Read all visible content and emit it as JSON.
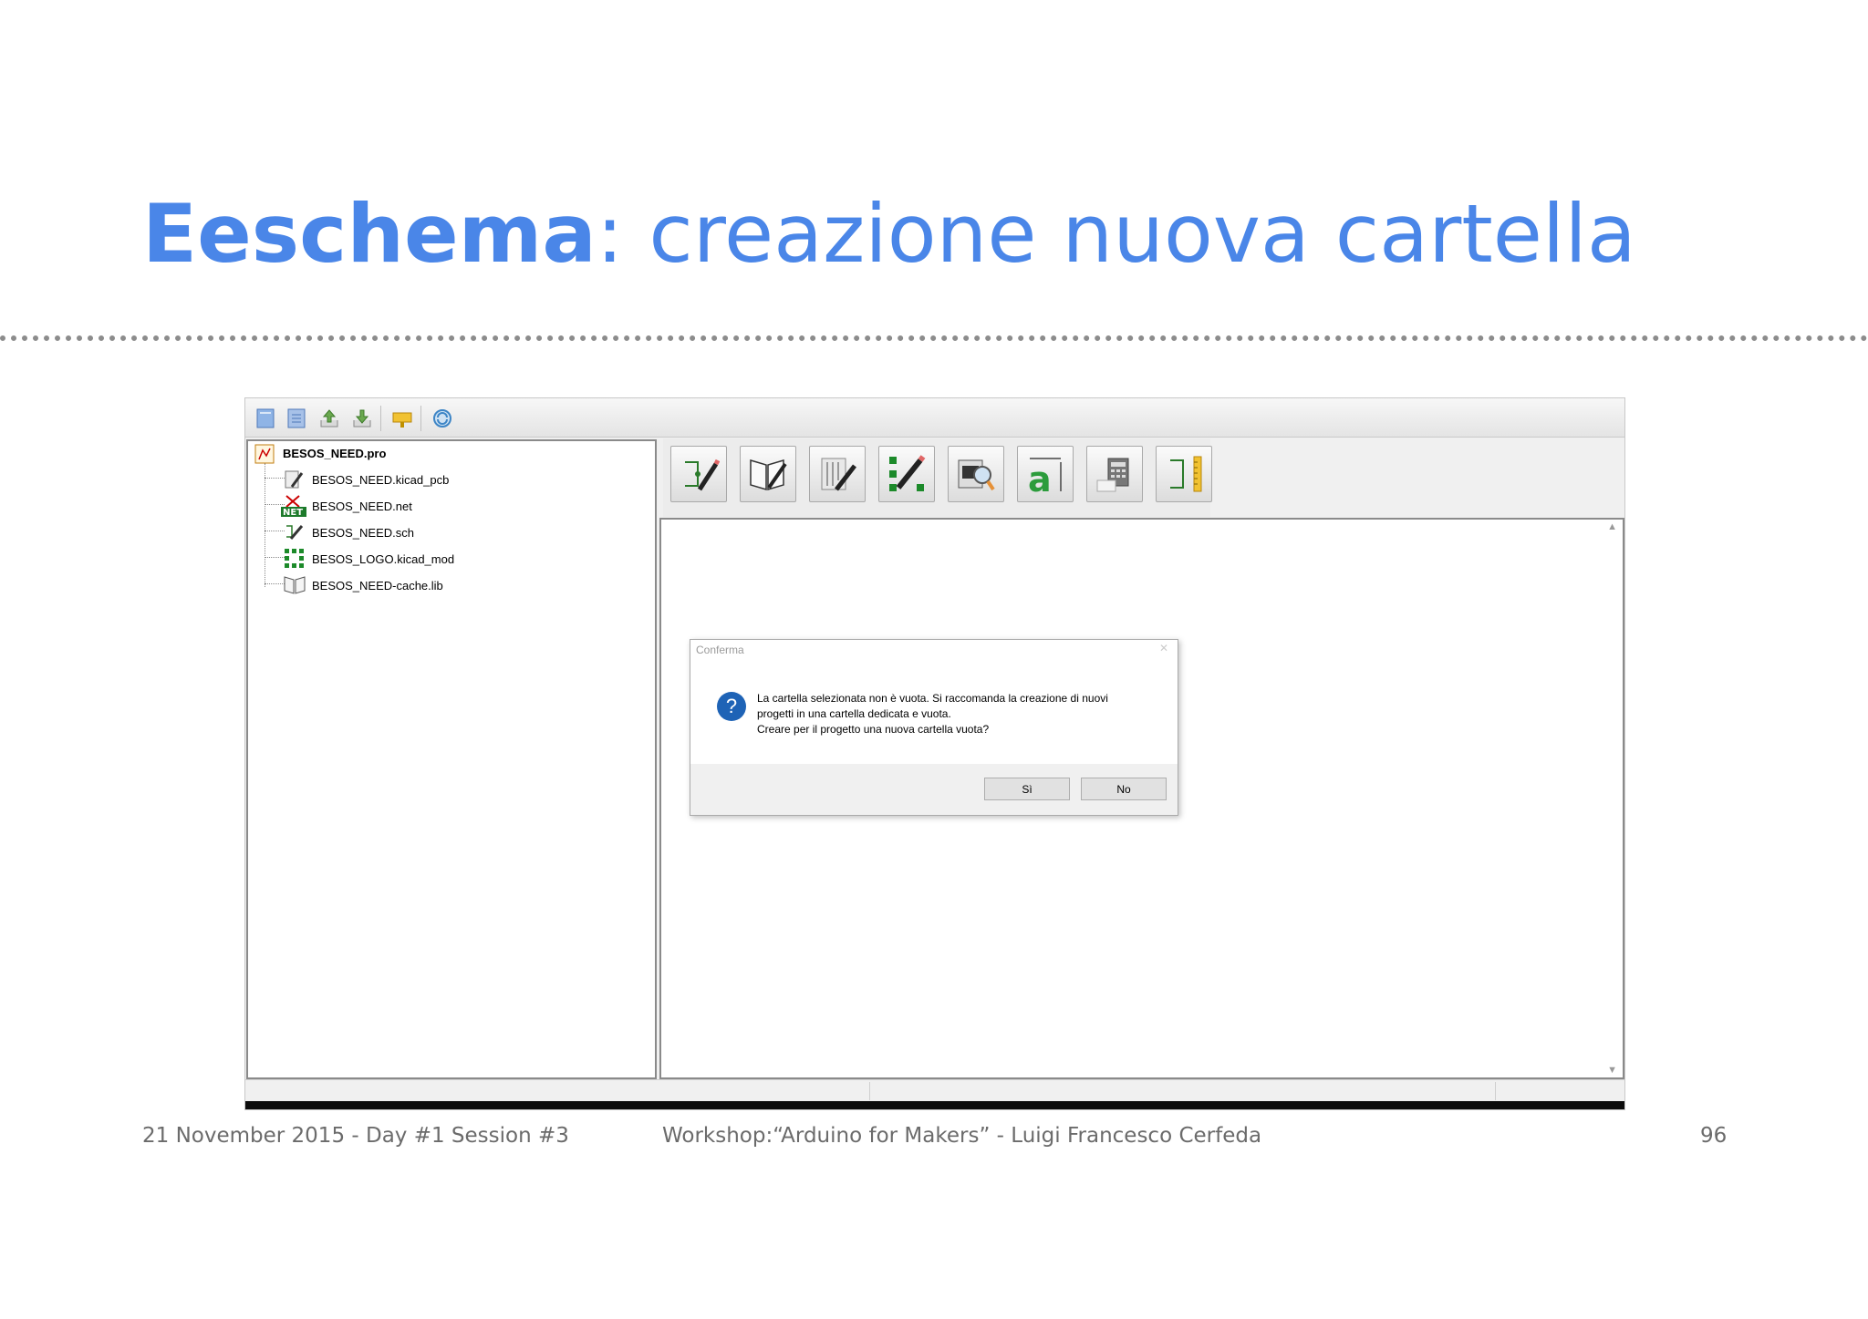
{
  "slide": {
    "title_bold": "Eeschema",
    "title_rest": ": creazione nuova cartella",
    "title_color": "#4a86e8"
  },
  "toolbar": {
    "icons": [
      "new-project-icon",
      "new-project-from-template-icon",
      "open-project-icon",
      "save-project-icon",
      "archive-icon",
      "refresh-icon"
    ]
  },
  "tree": {
    "root": "BESOS_NEED.pro",
    "items": [
      {
        "label": "BESOS_NEED.kicad_pcb",
        "icon": "pcb-file-icon"
      },
      {
        "label": "BESOS_NEED.net",
        "icon": "netlist-file-icon"
      },
      {
        "label": "BESOS_NEED.sch",
        "icon": "schematic-file-icon"
      },
      {
        "label": "BESOS_LOGO.kicad_mod",
        "icon": "footprint-file-icon"
      },
      {
        "label": "BESOS_NEED-cache.lib",
        "icon": "library-file-icon"
      }
    ]
  },
  "tools": [
    "eeschema-icon",
    "library-editor-icon",
    "pcbnew-icon",
    "footprint-editor-icon",
    "gerber-view-icon",
    "bitmap2component-icon",
    "pcb-calculator-icon",
    "worksheet-editor-icon"
  ],
  "dialog": {
    "title": "Conferma",
    "message_line1": "La cartella selezionata non è vuota. Si raccomanda la creazione di nuovi",
    "message_line2": "progetti in una cartella dedicata e vuota.",
    "message_line3": "Creare per il progetto una nuova cartella vuota?",
    "yes_label": "Sì",
    "no_label": "No"
  },
  "footer": {
    "left": "21 November 2015 - Day #1 Session #3",
    "center": "Workshop:“Arduino for Makers” - Luigi Francesco Cerfeda",
    "page": "96"
  }
}
